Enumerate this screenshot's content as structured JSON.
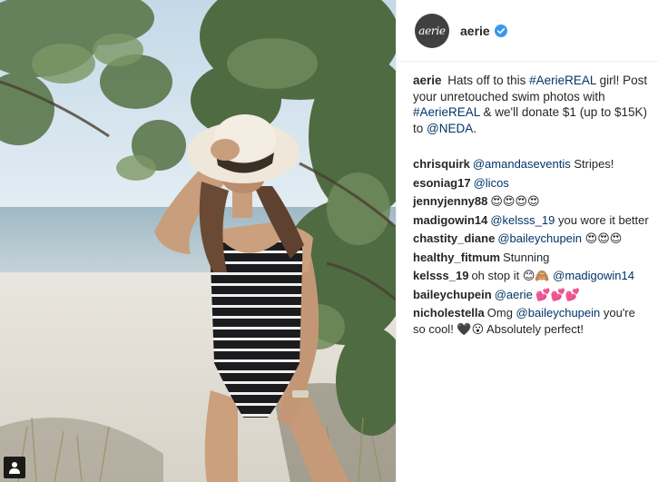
{
  "post": {
    "username": "aerie",
    "avatar_text": "aerie",
    "verified": true,
    "caption": {
      "username": "aerie",
      "parts": [
        {
          "text": "Hats off to this ",
          "link": false
        },
        {
          "text": "#AerieREAL",
          "link": true
        },
        {
          "text": " girl! Post your unretouched swim photos with ",
          "link": false
        },
        {
          "text": "#AerieREAL",
          "link": true
        },
        {
          "text": " & we'll donate $1 (up to $15K) to ",
          "link": false
        },
        {
          "text": "@NEDA",
          "link": true
        },
        {
          "text": ".",
          "link": false
        }
      ]
    }
  },
  "comments": [
    {
      "username": "chrisquirk",
      "parts": [
        {
          "text": "@amandaseventis",
          "link": true
        },
        {
          "text": " Stripes!",
          "link": false
        }
      ]
    },
    {
      "username": "esoniag17",
      "parts": [
        {
          "text": "@licos",
          "link": true
        }
      ]
    },
    {
      "username": "jennyjenny88",
      "parts": [
        {
          "text": "😍😍😍😍",
          "link": false
        }
      ]
    },
    {
      "username": "madigowin14",
      "parts": [
        {
          "text": "@kelsss_19",
          "link": true
        },
        {
          "text": " you wore it better",
          "link": false
        }
      ]
    },
    {
      "username": "chastity_diane",
      "parts": [
        {
          "text": "@baileychupein",
          "link": true
        },
        {
          "text": " 😍😍😍",
          "link": false
        }
      ]
    },
    {
      "username": "healthy_fitmum",
      "parts": [
        {
          "text": "Stunning",
          "link": false
        }
      ]
    },
    {
      "username": "kelsss_19",
      "parts": [
        {
          "text": "oh stop it 😊🙈 ",
          "link": false
        },
        {
          "text": "@madigowin14",
          "link": true
        }
      ]
    },
    {
      "username": "baileychupein",
      "parts": [
        {
          "text": "@aerie",
          "link": true
        },
        {
          "text": " 💕💕💕",
          "link": false
        }
      ]
    },
    {
      "username": "nicholestella",
      "parts": [
        {
          "text": "Omg ",
          "link": false
        },
        {
          "text": "@baileychupein",
          "link": true
        },
        {
          "text": " you're so cool! 🖤😮 Absolutely perfect!",
          "link": false
        }
      ]
    }
  ],
  "colors": {
    "link": "#003569",
    "verified": "#3897f0",
    "divider": "#efefef",
    "avatar_bg": "#404040"
  },
  "icons": {
    "verified": "verified-badge-icon",
    "tag": "user-tag-icon"
  }
}
